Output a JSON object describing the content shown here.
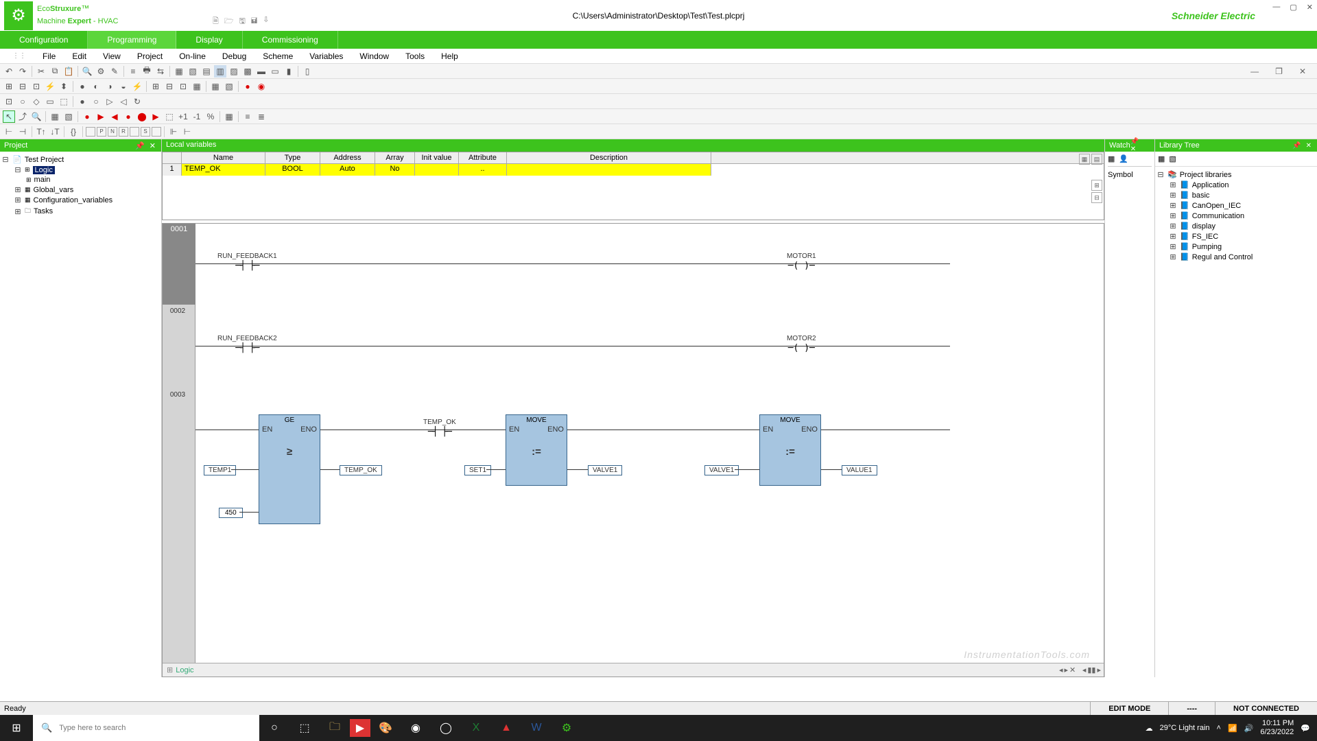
{
  "title_path": "C:\\Users\\Administrator\\Desktop\\Test\\Test.plcprj",
  "brand": {
    "eco": "Eco",
    "struxure": "Struxure",
    "machine": "Machine",
    "expert": " Expert",
    "hvac": " - HVAC",
    "schneider": "Schneider Electric"
  },
  "green_tabs": [
    "Configuration",
    "Programming",
    "Display",
    "Commissioning"
  ],
  "green_active": 1,
  "menu": [
    "File",
    "Edit",
    "View",
    "Project",
    "On-line",
    "Debug",
    "Scheme",
    "Variables",
    "Window",
    "Tools",
    "Help"
  ],
  "project_panel": {
    "title": "Project",
    "tree": [
      {
        "lvl": 0,
        "exp": "−",
        "icon": "📄",
        "label": "Test Project"
      },
      {
        "lvl": 1,
        "exp": "−",
        "icon": "",
        "label": "Logic",
        "sel": true
      },
      {
        "lvl": 2,
        "exp": "",
        "icon": "",
        "label": "main"
      },
      {
        "lvl": 1,
        "exp": "+",
        "icon": "",
        "label": "Global_vars"
      },
      {
        "lvl": 1,
        "exp": "+",
        "icon": "",
        "label": "Configuration_variables"
      },
      {
        "lvl": 1,
        "exp": "+",
        "icon": "",
        "label": "Tasks"
      }
    ]
  },
  "vars": {
    "title": "Local variables",
    "columns": [
      "",
      "Name",
      "Type",
      "Address",
      "Array",
      "Init value",
      "Attribute",
      "Description"
    ],
    "rows": [
      {
        "n": "1",
        "name": "TEMP_OK",
        "type": "BOOL",
        "addr": "Auto",
        "arr": "No",
        "init": "",
        "attr": "..",
        "desc": ""
      }
    ]
  },
  "ladder": {
    "rungs": [
      {
        "num": "0001",
        "contact": "RUN_FEEDBACK1",
        "coil": "MOTOR1"
      },
      {
        "num": "0002",
        "contact": "RUN_FEEDBACK2",
        "coil": "MOTOR2"
      },
      {
        "num": "0003"
      }
    ],
    "fb": [
      {
        "name": "GE",
        "sym": "≥",
        "in": [
          "TEMP1",
          "450"
        ],
        "out": "TEMP_OK"
      },
      {
        "name": "MOVE",
        "sym": ":=",
        "mid_contact": "TEMP_OK",
        "in": [
          "SET1"
        ],
        "out": "VALVE1"
      },
      {
        "name": "MOVE",
        "sym": ":=",
        "in": [
          "VALVE1"
        ],
        "out": "VALUE1"
      }
    ]
  },
  "bottom_tab": "Logic",
  "watch": {
    "title": "Watch",
    "col": "Symbol"
  },
  "lib": {
    "title": "Library Tree",
    "root": "Project libraries",
    "items": [
      "Application",
      "basic",
      "CanOpen_IEC",
      "Communication",
      "display",
      "FS_IEC",
      "Pumping",
      "Regul and Control"
    ]
  },
  "status": {
    "ready": "Ready",
    "mode": "EDIT MODE",
    "mid": "----",
    "conn": "NOT CONNECTED"
  },
  "taskbar": {
    "search_placeholder": "Type here to search",
    "weather": "29°C  Light rain",
    "time": "10:11 PM",
    "date": "6/23/2022"
  },
  "watermark": "InstrumentationTools.com"
}
